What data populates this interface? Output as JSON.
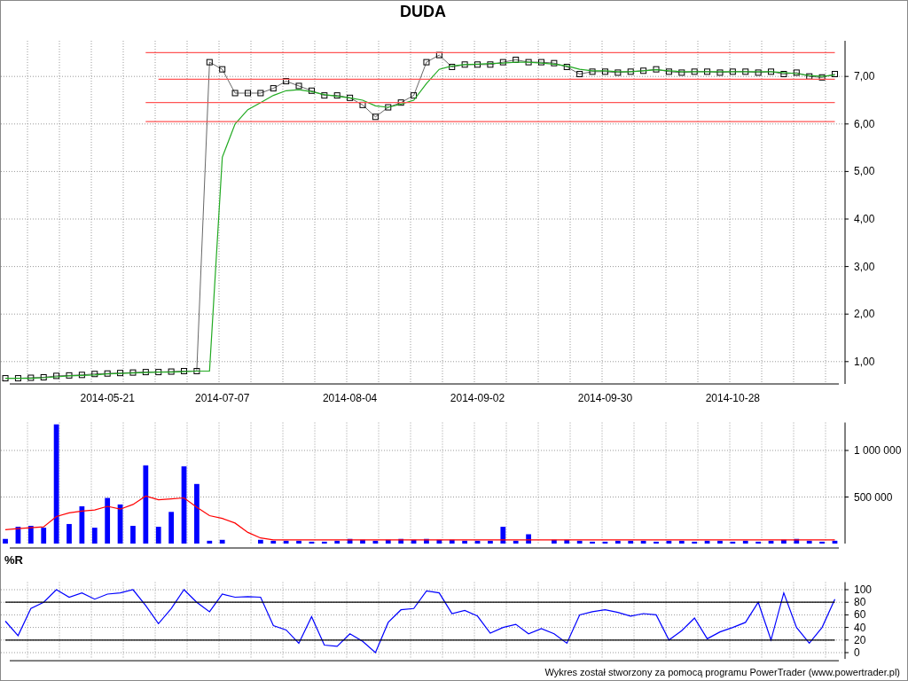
{
  "panels": [
    {
      "chart_data": {
        "type": "line",
        "title": "DUDA",
        "grid": true,
        "categories": [
          null,
          null,
          null,
          null,
          null,
          null,
          null,
          null,
          "2014-05-21",
          null,
          null,
          null,
          null,
          null,
          null,
          null,
          null,
          "2014-07-07",
          null,
          null,
          null,
          null,
          null,
          null,
          null,
          null,
          null,
          "2014-08-04",
          null,
          null,
          null,
          null,
          null,
          null,
          null,
          null,
          null,
          "2014-09-02",
          null,
          null,
          null,
          null,
          null,
          null,
          null,
          null,
          null,
          "2014-09-30",
          null,
          null,
          null,
          null,
          null,
          null,
          null,
          null,
          null,
          "2014-10-28",
          null,
          null,
          null,
          null,
          null,
          null,
          null,
          null
        ],
        "ylim": [
          0.53,
          7.75
        ],
        "yticks": [
          {
            "value": 7,
            "label": "7,00"
          },
          {
            "value": 6,
            "label": "6,00"
          },
          {
            "value": 5,
            "label": "5,00"
          },
          {
            "value": 4,
            "label": "4,00"
          },
          {
            "value": 3,
            "label": "3,00"
          },
          {
            "value": 2,
            "label": "2,00"
          },
          {
            "value": 1,
            "label": "1,00"
          }
        ],
        "series": [
          {
            "marker": true,
            "color": "#000000",
            "values": [
              0.65,
              0.65,
              0.66,
              0.67,
              0.7,
              0.71,
              0.72,
              0.74,
              0.75,
              0.76,
              0.77,
              0.78,
              0.78,
              0.79,
              0.8,
              0.8,
              7.3,
              7.15,
              6.65,
              6.65,
              6.65,
              6.75,
              6.9,
              6.8,
              6.7,
              6.6,
              6.6,
              6.55,
              6.4,
              6.15,
              6.35,
              6.45,
              6.6,
              7.3,
              7.45,
              7.2,
              7.25,
              7.25,
              7.25,
              7.3,
              7.35,
              7.3,
              7.3,
              7.28,
              7.2,
              7.05,
              7.1,
              7.1,
              7.08,
              7.1,
              7.12,
              7.15,
              7.1,
              7.08,
              7.1,
              7.1,
              7.08,
              7.1,
              7.1,
              7.08,
              7.1,
              7.05,
              7.08,
              7.0,
              6.98,
              7.05
            ]
          },
          {
            "color": "#22aa22",
            "values": [
              0.65,
              0.65,
              0.65,
              0.66,
              0.68,
              0.7,
              0.71,
              0.72,
              0.74,
              0.75,
              0.76,
              0.77,
              0.78,
              0.78,
              0.79,
              0.8,
              0.8,
              5.3,
              6.0,
              6.3,
              6.45,
              6.6,
              6.7,
              6.72,
              6.68,
              6.62,
              6.58,
              6.55,
              6.5,
              6.38,
              6.35,
              6.42,
              6.5,
              6.85,
              7.15,
              7.22,
              7.25,
              7.26,
              7.27,
              7.28,
              7.3,
              7.3,
              7.28,
              7.26,
              7.22,
              7.15,
              7.12,
              7.12,
              7.1,
              7.1,
              7.12,
              7.14,
              7.12,
              7.1,
              7.1,
              7.1,
              7.1,
              7.1,
              7.1,
              7.1,
              7.1,
              7.08,
              7.06,
              7.02,
              7.0,
              7.03
            ]
          },
          {
            "color": "#ff5555",
            "values": [
              null,
              null,
              null,
              null,
              null,
              null,
              null,
              null,
              null,
              null,
              null,
              7.5,
              7.5,
              7.5,
              7.5,
              7.5,
              7.5,
              7.5,
              7.5,
              7.5,
              7.5,
              7.5,
              7.5,
              7.5,
              7.5,
              7.5,
              7.5,
              7.5,
              7.5,
              7.5,
              7.5,
              7.5,
              7.5,
              7.5,
              7.5,
              7.5,
              7.5,
              7.5,
              7.5,
              7.5,
              7.5,
              7.5,
              7.5,
              7.5,
              7.5,
              7.5,
              7.5,
              7.5,
              7.5,
              7.5,
              7.5,
              7.5,
              7.5,
              7.5,
              7.5,
              7.5,
              7.5,
              7.5,
              7.5,
              7.5,
              7.5,
              7.5,
              7.5,
              7.5,
              7.5,
              7.5
            ]
          },
          {
            "color": "#ff5555",
            "values": [
              null,
              null,
              null,
              null,
              null,
              null,
              null,
              null,
              null,
              null,
              null,
              null,
              6.94,
              6.94,
              6.94,
              6.94,
              6.94,
              6.94,
              6.94,
              6.94,
              6.94,
              6.94,
              6.94,
              6.94,
              6.94,
              6.94,
              6.94,
              6.94,
              6.94,
              6.94,
              6.94,
              6.94,
              6.94,
              6.94,
              6.94,
              6.94,
              6.94,
              6.94,
              6.94,
              6.94,
              6.94,
              6.94,
              6.94,
              6.94,
              6.94,
              6.94,
              6.94,
              6.94,
              6.94,
              6.94,
              6.94,
              6.94,
              6.94,
              6.94,
              6.94,
              6.94,
              6.94,
              6.94,
              6.94,
              6.94,
              6.94,
              6.94,
              6.94,
              6.94,
              6.94,
              6.94
            ]
          },
          {
            "color": "#ff5555",
            "values": [
              null,
              null,
              null,
              null,
              null,
              null,
              null,
              null,
              null,
              null,
              null,
              6.45,
              6.45,
              6.45,
              6.45,
              6.45,
              6.45,
              6.45,
              6.45,
              6.45,
              6.45,
              6.45,
              6.45,
              6.45,
              6.45,
              6.45,
              6.45,
              6.45,
              6.45,
              6.45,
              6.45,
              6.45,
              6.45,
              6.45,
              6.45,
              6.45,
              6.45,
              6.45,
              6.45,
              6.45,
              6.45,
              6.45,
              6.45,
              6.45,
              6.45,
              6.45,
              6.45,
              6.45,
              6.45,
              6.45,
              6.45,
              6.45,
              6.45,
              6.45,
              6.45,
              6.45,
              6.45,
              6.45,
              6.45,
              6.45,
              6.45,
              6.45,
              6.45,
              6.45,
              6.45,
              6.45
            ]
          },
          {
            "color": "#ff5555",
            "values": [
              null,
              null,
              null,
              null,
              null,
              null,
              null,
              null,
              null,
              null,
              null,
              6.05,
              6.05,
              6.05,
              6.05,
              6.05,
              6.05,
              6.05,
              6.05,
              6.05,
              6.05,
              6.05,
              6.05,
              6.05,
              6.05,
              6.05,
              6.05,
              6.05,
              6.05,
              6.05,
              6.05,
              6.05,
              6.05,
              6.05,
              6.05,
              6.05,
              6.05,
              6.05,
              6.05,
              6.05,
              6.05,
              6.05,
              6.05,
              6.05,
              6.05,
              6.05,
              6.05,
              6.05,
              6.05,
              6.05,
              6.05,
              6.05,
              6.05,
              6.05,
              6.05,
              6.05,
              6.05,
              6.05,
              6.05,
              6.05,
              6.05,
              6.05,
              6.05,
              6.05,
              6.05,
              6.05
            ]
          }
        ]
      }
    },
    {
      "chart_data": {
        "type": "bar",
        "grid": true,
        "ylim": [
          0,
          1300000
        ],
        "yticks": [
          {
            "value": 1000000,
            "label": "1 000 000"
          },
          {
            "value": 500000,
            "label": "500 000"
          }
        ],
        "series": [
          {
            "color": "#0000ff",
            "values": [
              50000,
              180000,
              190000,
              170000,
              1280000,
              210000,
              400000,
              170000,
              490000,
              420000,
              190000,
              840000,
              180000,
              340000,
              830000,
              640000,
              30000,
              40000,
              0,
              0,
              40000,
              30000,
              30000,
              30000,
              20000,
              20000,
              30000,
              50000,
              40000,
              30000,
              40000,
              50000,
              40000,
              50000,
              40000,
              40000,
              30000,
              30000,
              30000,
              180000,
              30000,
              100000,
              0,
              40000,
              40000,
              30000,
              20000,
              20000,
              30000,
              30000,
              30000,
              20000,
              30000,
              30000,
              20000,
              30000,
              30000,
              20000,
              30000,
              20000,
              30000,
              40000,
              50000,
              30000,
              20000,
              30000
            ]
          },
          {
            "type": "line",
            "color": "#ff0000",
            "values": [
              150000,
              160000,
              170000,
              180000,
              290000,
              330000,
              350000,
              360000,
              400000,
              370000,
              420000,
              510000,
              470000,
              480000,
              490000,
              390000,
              300000,
              270000,
              220000,
              120000,
              60000,
              40000,
              40000,
              40000,
              40000,
              40000,
              40000,
              40000,
              40000,
              40000,
              40000,
              40000,
              40000,
              40000,
              40000,
              40000,
              40000,
              40000,
              40000,
              40000,
              40000,
              40000,
              40000,
              40000,
              40000,
              40000,
              40000,
              40000,
              40000,
              40000,
              40000,
              40000,
              40000,
              40000,
              40000,
              40000,
              40000,
              40000,
              40000,
              40000,
              40000,
              40000,
              40000,
              40000,
              40000,
              40000
            ]
          }
        ]
      }
    },
    {
      "chart_data": {
        "type": "line",
        "title": "%R",
        "grid": true,
        "ylim": [
          -10,
          112
        ],
        "yticks": [
          {
            "value": 100,
            "label": "100"
          },
          {
            "value": 80,
            "label": "80"
          },
          {
            "value": 60,
            "label": "60"
          },
          {
            "value": 40,
            "label": "40"
          },
          {
            "value": 20,
            "label": "20"
          },
          {
            "value": 0,
            "label": "0"
          }
        ],
        "series": [
          {
            "color": "#0000ff",
            "values": [
              50,
              27,
              70,
              80,
              100,
              88,
              95,
              85,
              93,
              95,
              100,
              75,
              46,
              70,
              100,
              80,
              65,
              93,
              88,
              89,
              88,
              43,
              36,
              15,
              57,
              12,
              10,
              30,
              18,
              0,
              48,
              68,
              70,
              98,
              95,
              62,
              67,
              58,
              31,
              40,
              45,
              30,
              38,
              30,
              15,
              60,
              65,
              68,
              64,
              58,
              62,
              60,
              20,
              35,
              55,
              22,
              33,
              40,
              48,
              80,
              20,
              95,
              40,
              15,
              40,
              85
            ]
          },
          {
            "color": "#000000",
            "values": [
              80,
              80,
              80,
              80,
              80,
              80,
              80,
              80,
              80,
              80,
              80,
              80,
              80,
              80,
              80,
              80,
              80,
              80,
              80,
              80,
              80,
              80,
              80,
              80,
              80,
              80,
              80,
              80,
              80,
              80,
              80,
              80,
              80,
              80,
              80,
              80,
              80,
              80,
              80,
              80,
              80,
              80,
              80,
              80,
              80,
              80,
              80,
              80,
              80,
              80,
              80,
              80,
              80,
              80,
              80,
              80,
              80,
              80,
              80,
              80,
              80,
              80,
              80,
              80,
              80,
              80
            ]
          },
          {
            "color": "#000000",
            "values": [
              20,
              20,
              20,
              20,
              20,
              20,
              20,
              20,
              20,
              20,
              20,
              20,
              20,
              20,
              20,
              20,
              20,
              20,
              20,
              20,
              20,
              20,
              20,
              20,
              20,
              20,
              20,
              20,
              20,
              20,
              20,
              20,
              20,
              20,
              20,
              20,
              20,
              20,
              20,
              20,
              20,
              20,
              20,
              20,
              20,
              20,
              20,
              20,
              20,
              20,
              20,
              20,
              20,
              20,
              20,
              20,
              20,
              20,
              20,
              20,
              20,
              20,
              20,
              20,
              20,
              20
            ]
          }
        ]
      }
    }
  ],
  "footer": "Wykres został stworzony za pomocą programu PowerTrader (www.powertrader.pl)"
}
